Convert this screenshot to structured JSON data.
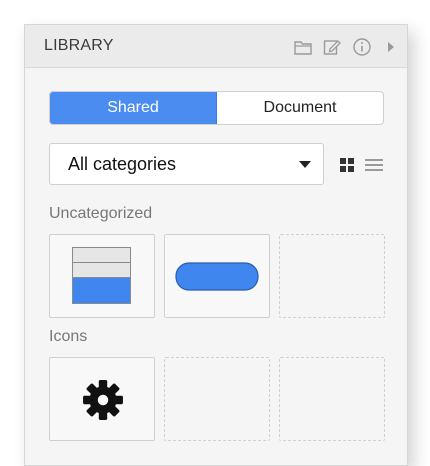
{
  "panel": {
    "title": "LIBRARY",
    "header_icons": [
      "folder-icon",
      "edit-icon",
      "info-icon",
      "expand-right-icon"
    ]
  },
  "tabs": [
    {
      "label": "Shared",
      "active": true
    },
    {
      "label": "Document",
      "active": false
    }
  ],
  "category_select": {
    "value": "All categories",
    "icon": "chevron-down-icon"
  },
  "view_icons": [
    "grid-view-icon",
    "list-view-icon"
  ],
  "sections": [
    {
      "title": "Uncategorized",
      "items": [
        "table-widget",
        "blue-button-widget",
        "empty-slot"
      ]
    },
    {
      "title": "Icons",
      "items": [
        "gear-icon",
        "empty-slot",
        "empty-slot"
      ]
    }
  ],
  "colors": {
    "accent": "#4a8cf0",
    "panel_bg": "#f5f5f5",
    "header_bg": "#ebebeb"
  }
}
